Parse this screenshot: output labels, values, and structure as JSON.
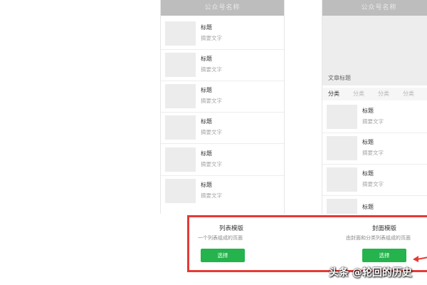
{
  "left_preview": {
    "header_title": "公众号名称",
    "articles": [
      {
        "title": "标题",
        "summary": "摘要文字"
      },
      {
        "title": "标题",
        "summary": "摘要文字"
      },
      {
        "title": "标题",
        "summary": "摘要文字"
      },
      {
        "title": "标题",
        "summary": "摘要文字"
      },
      {
        "title": "标题",
        "summary": "摘要文字"
      },
      {
        "title": "标题",
        "summary": "摘要文字"
      }
    ]
  },
  "right_preview": {
    "header_title": "公众号名称",
    "cover_title": "文章标题",
    "categories": [
      "分类",
      "分类",
      "分类",
      "分类"
    ],
    "articles": [
      {
        "title": "标题",
        "summary": "摘要文字"
      },
      {
        "title": "标题",
        "summary": "摘要文字"
      },
      {
        "title": "标题",
        "summary": "摘要文字"
      },
      {
        "title": "标题",
        "summary": ""
      }
    ]
  },
  "templates": [
    {
      "name": "列表模版",
      "description": "一个列表组成的页面",
      "button_label": "选择"
    },
    {
      "name": "封面模版",
      "description": "由封面和分类列表组成的页面",
      "button_label": "选择"
    }
  ],
  "colors": {
    "highlight_border": "#e53935",
    "button_green": "#24b34c",
    "header_gray": "#bdbdbd"
  },
  "watermark": "头条 @轮回的历史"
}
